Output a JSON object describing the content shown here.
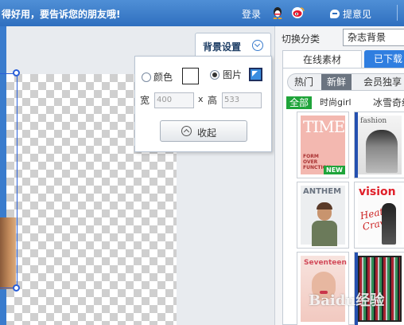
{
  "topbar": {
    "promo_text": "得好用，要告诉您的朋友哦!",
    "login_label": "登录",
    "qq_icon": "qq-penguin-icon",
    "weibo_icon": "weibo-icon",
    "feedback_label": "提意见",
    "colors": {
      "background": "#3a7ccd",
      "text": "#ffffff"
    }
  },
  "background_settings": {
    "tab_label": "背景设置",
    "color_option_label": "颜色",
    "image_option_label": "图片",
    "selected_option": "image",
    "width_label": "宽",
    "width_value": "400",
    "times_symbol": "x",
    "height_label": "高",
    "height_value": "533",
    "collapse_label": "收起"
  },
  "right_panel": {
    "switch_category_label": "切换分类",
    "category_select_value": "杂志背景",
    "tabs": [
      {
        "label": "在线素材",
        "active": true
      },
      {
        "label": "已下载",
        "active": false
      }
    ],
    "filter_pills": [
      {
        "label": "热门",
        "active": false
      },
      {
        "label": "新鲜",
        "active": true
      },
      {
        "label": "会员独享",
        "active": false
      }
    ],
    "categories": [
      {
        "label": "全部",
        "active": true
      },
      {
        "label": "时尚girl",
        "active": false
      },
      {
        "label": "冰雪奇缘",
        "active": false
      }
    ],
    "thumbnails": [
      {
        "title": "TIME",
        "subtitle": "FORM OVER FUNCTION",
        "badge": "NEW"
      },
      {
        "title": "fashion"
      },
      {
        "title": "ANTHEM"
      },
      {
        "title": "vision",
        "script": "Heat Crave"
      },
      {
        "title": "Seventeen"
      },
      {
        "title": ""
      }
    ],
    "accent_green": "#1fa43a",
    "accent_blue": "#2f7ee0"
  },
  "watermark": "Baidu经验"
}
